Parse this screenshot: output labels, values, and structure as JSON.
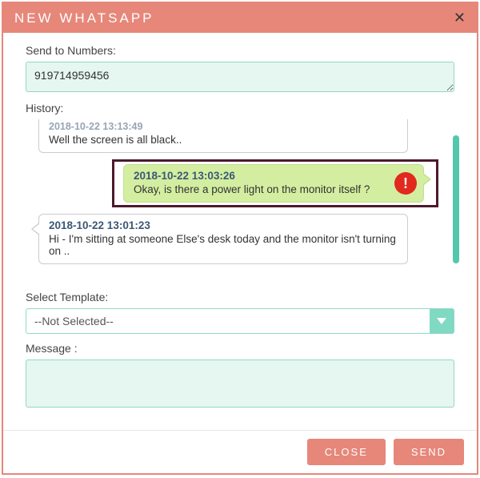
{
  "header": {
    "title": "NEW WHATSAPP"
  },
  "labels": {
    "send_to": "Send to Numbers:",
    "history": "History:",
    "select_template": "Select Template:",
    "message": "Message :"
  },
  "numbers_value": "919714959456",
  "history": [
    {
      "timestamp": "2018-10-22 13:13:49",
      "text": "Well the screen is all black..",
      "side": "left",
      "cutoff": true
    },
    {
      "timestamp": "2018-10-22 13:03:26",
      "text": "Okay, is there a power light on the monitor itself ?",
      "side": "right",
      "alert": true,
      "highlighted": true
    },
    {
      "timestamp": "2018-10-22 13:01:23",
      "text": "Hi - I'm sitting at someone Else's desk today and the monitor isn't turning on ..",
      "side": "left"
    }
  ],
  "template": {
    "selected": "--Not Selected--"
  },
  "message_value": "",
  "footer": {
    "close": "CLOSE",
    "send": "SEND"
  }
}
